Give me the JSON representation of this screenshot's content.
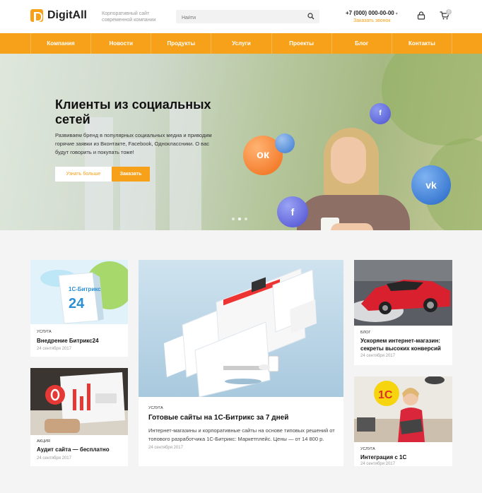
{
  "header": {
    "logo": "DigitAll",
    "tagline": "Корпоративный сайт современной компании",
    "search_placeholder": "Найти",
    "phone": "+7 (000) 000-00-00",
    "callback": "Заказать звонок",
    "cart_count": "0"
  },
  "nav": {
    "items": [
      "Компания",
      "Новости",
      "Продукты",
      "Услуги",
      "Проекты",
      "Блог",
      "Контакты"
    ]
  },
  "hero": {
    "title": "Клиенты из социальных сетей",
    "text": "Развиваем бренд в популярных социальных медиа и приводим горячие заявки из Вконтакте, Facebook, Одноклассники. О вас будут говорить и покупать тоже!",
    "btn_more": "Узнать больше",
    "btn_order": "Заказать",
    "slides_total": 3,
    "slide_active": 2
  },
  "cards": [
    {
      "tag": "Услуга",
      "title": "Внедрение Битрикс24",
      "date": "24 сентября 2017",
      "img_label": "1С-Битрикс",
      "img_num": "24"
    },
    {
      "tag": "Акция",
      "title": "Аудит сайта — бесплатно",
      "date": "24 сентября 2017"
    },
    {
      "tag": "Услуга",
      "title": "Готовые сайты на 1С-Битрикс за 7 дней",
      "desc": "Интернет-магазины и корпоративные сайты на основе типовых решений от топового разработчика 1С-Битрикс: Маркетплейс. Цены — от 14 800 р.",
      "date": "24 сентября 2017"
    },
    {
      "tag": "Блог",
      "title": "Ускоряем интернет-магазин: секреты высоких конверсий",
      "date": "24 сентября 2017"
    },
    {
      "tag": "Услуга",
      "title": "Интеграция с 1С",
      "date": "24 сентября 2017",
      "img_label": "1С"
    }
  ],
  "colors": {
    "accent": "#f7a11a",
    "background": "#f4f4f4"
  }
}
